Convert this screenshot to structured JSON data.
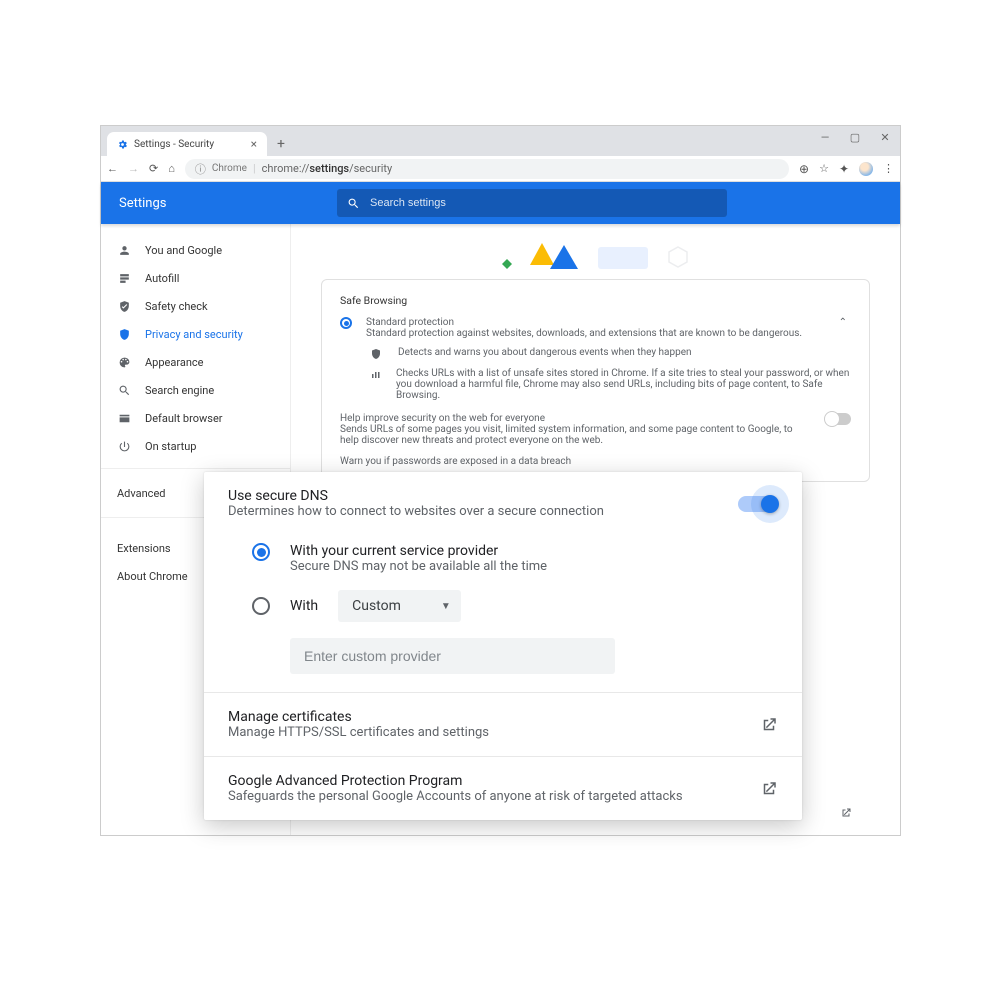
{
  "window": {
    "tab_title": "Settings - Security",
    "url_prefix": "Chrome",
    "url_path": "chrome://settings/security",
    "url_bold": "settings"
  },
  "header": {
    "title": "Settings",
    "search_placeholder": "Search settings"
  },
  "sidebar": {
    "items": [
      {
        "label": "You and Google"
      },
      {
        "label": "Autofill"
      },
      {
        "label": "Safety check"
      },
      {
        "label": "Privacy and security"
      },
      {
        "label": "Appearance"
      },
      {
        "label": "Search engine"
      },
      {
        "label": "Default browser"
      },
      {
        "label": "On startup"
      }
    ],
    "advanced": "Advanced",
    "extensions": "Extensions",
    "about": "About Chrome"
  },
  "main": {
    "section_title": "Safe Browsing",
    "std": {
      "title": "Standard protection",
      "desc": "Standard protection against websites, downloads, and extensions that are known to be dangerous.",
      "detect": "Detects and warns you about dangerous events when they happen",
      "checks": "Checks URLs with a list of unsafe sites stored in Chrome. If a site tries to steal your password, or when you download a harmful file, Chrome may also send URLs, including bits of page content, to Safe Browsing."
    },
    "help": {
      "title": "Help improve security on the web for everyone",
      "desc": "Sends URLs of some pages you visit, limited system information, and some page content to Google, to help discover new threats and protect everyone on the web."
    },
    "breach": "Warn you if passwords are exposed in a data breach",
    "adv_prot": {
      "desc": "Safeguards the personal Google Accounts of anyone at risk of targeted attacks"
    }
  },
  "overlay": {
    "dns": {
      "title": "Use secure DNS",
      "desc": "Determines how to connect to websites over a secure connection"
    },
    "opt1": {
      "title": "With your current service provider",
      "desc": "Secure DNS may not be available all the time"
    },
    "opt2": {
      "label": "With",
      "dropdown": "Custom",
      "placeholder": "Enter custom provider"
    },
    "certs": {
      "title": "Manage certificates",
      "desc": "Manage HTTPS/SSL certificates and settings"
    },
    "adv": {
      "title": "Google Advanced Protection Program",
      "desc": "Safeguards the personal Google Accounts of anyone at risk of targeted attacks"
    }
  }
}
